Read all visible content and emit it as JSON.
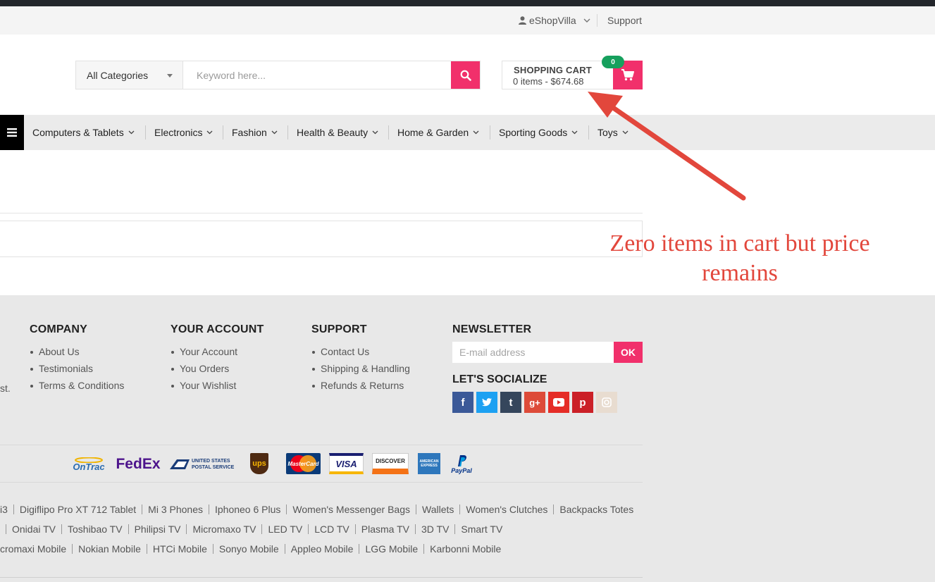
{
  "topbar": {
    "account_label": "eShopVilla",
    "support_label": "Support"
  },
  "search": {
    "category_selected": "All Categories",
    "placeholder": "Keyword here..."
  },
  "cart": {
    "title": "SHOPPING CART",
    "summary": "0 items - $674.68",
    "badge_count": "0"
  },
  "nav": {
    "items": [
      {
        "label": "Computers & Tablets"
      },
      {
        "label": "Electronics"
      },
      {
        "label": "Fashion"
      },
      {
        "label": "Health & Beauty"
      },
      {
        "label": "Home & Garden"
      },
      {
        "label": "Sporting Goods"
      },
      {
        "label": "Toys"
      }
    ]
  },
  "annotation": {
    "line1": "Zero items in cart but price",
    "line2": "remains"
  },
  "footer": {
    "left_cut_text": "st.",
    "company": {
      "heading": "COMPANY",
      "links": [
        "About Us",
        "Testimonials",
        "Terms & Conditions"
      ]
    },
    "account": {
      "heading": "YOUR ACCOUNT",
      "links": [
        "Your Account",
        "You Orders",
        "Your Wishlist"
      ]
    },
    "support": {
      "heading": "SUPPORT",
      "links": [
        "Contact Us",
        "Shipping & Handling",
        "Refunds & Returns"
      ]
    },
    "newsletter": {
      "heading": "NEWSLETTER",
      "placeholder": "E-mail address",
      "button": "OK",
      "social_heading": "LET'S SOCIALIZE"
    },
    "shipping_logos": [
      "OnTrac",
      "FedEx",
      "UNITED STATES POSTAL SERVICE",
      "ups"
    ],
    "payment_logos": [
      "MasterCard",
      "VISA",
      "DISCOVER",
      "AMERICAN EXPRESS",
      "PayPal"
    ],
    "tag_rows": [
      [
        "i3",
        "Digiflipo Pro XT 712 Tablet",
        "Mi 3 Phones",
        "Iphoneo 6 Plus",
        "Women's Messenger Bags",
        "Wallets",
        "Women's Clutches",
        "Backpacks Totes"
      ],
      [
        "",
        "Onidai TV",
        "Toshibao TV",
        "Philipsi TV",
        "Micromaxo TV",
        "LED TV",
        "LCD TV",
        "Plasma TV",
        "3D TV",
        "Smart TV"
      ],
      [
        "cromaxi Mobile",
        "Nokian Mobile",
        "HTCi Mobile",
        "Sonyo Mobile",
        "Appleo Mobile",
        "LGG Mobile",
        "Karbonni Mobile"
      ]
    ]
  },
  "colors": {
    "accent": "#f1306b",
    "badge": "#16a05d",
    "annotation": "#e2473c"
  }
}
